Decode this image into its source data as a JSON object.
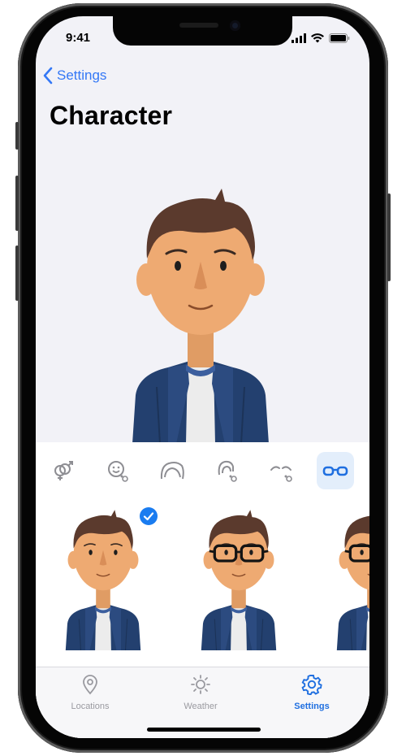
{
  "status": {
    "time": "9:41"
  },
  "nav": {
    "back_label": "Settings"
  },
  "page": {
    "title": "Character"
  },
  "categories": [
    {
      "icon": "gender-icon",
      "active": false
    },
    {
      "icon": "face-icon",
      "active": false
    },
    {
      "icon": "hair-icon",
      "active": false
    },
    {
      "icon": "hairstyle-icon",
      "active": false
    },
    {
      "icon": "eyebrows-icon",
      "active": false
    },
    {
      "icon": "glasses-icon",
      "active": true
    }
  ],
  "options": [
    {
      "variant": "no-glasses",
      "selected": true
    },
    {
      "variant": "black-glasses",
      "selected": false
    },
    {
      "variant": "black-glasses",
      "selected": false
    }
  ],
  "tabs": [
    {
      "label": "Locations",
      "icon": "location-pin-icon",
      "active": false
    },
    {
      "label": "Weather",
      "icon": "sun-icon",
      "active": false
    },
    {
      "label": "Settings",
      "icon": "gear-icon",
      "active": true
    }
  ],
  "colors": {
    "accent": "#3478f6",
    "skin": "#eeaa72",
    "hair": "#5b3a2d",
    "jacket": "#23406f",
    "shirt": "#eeeeee",
    "inactive": "#9a9aa0"
  }
}
